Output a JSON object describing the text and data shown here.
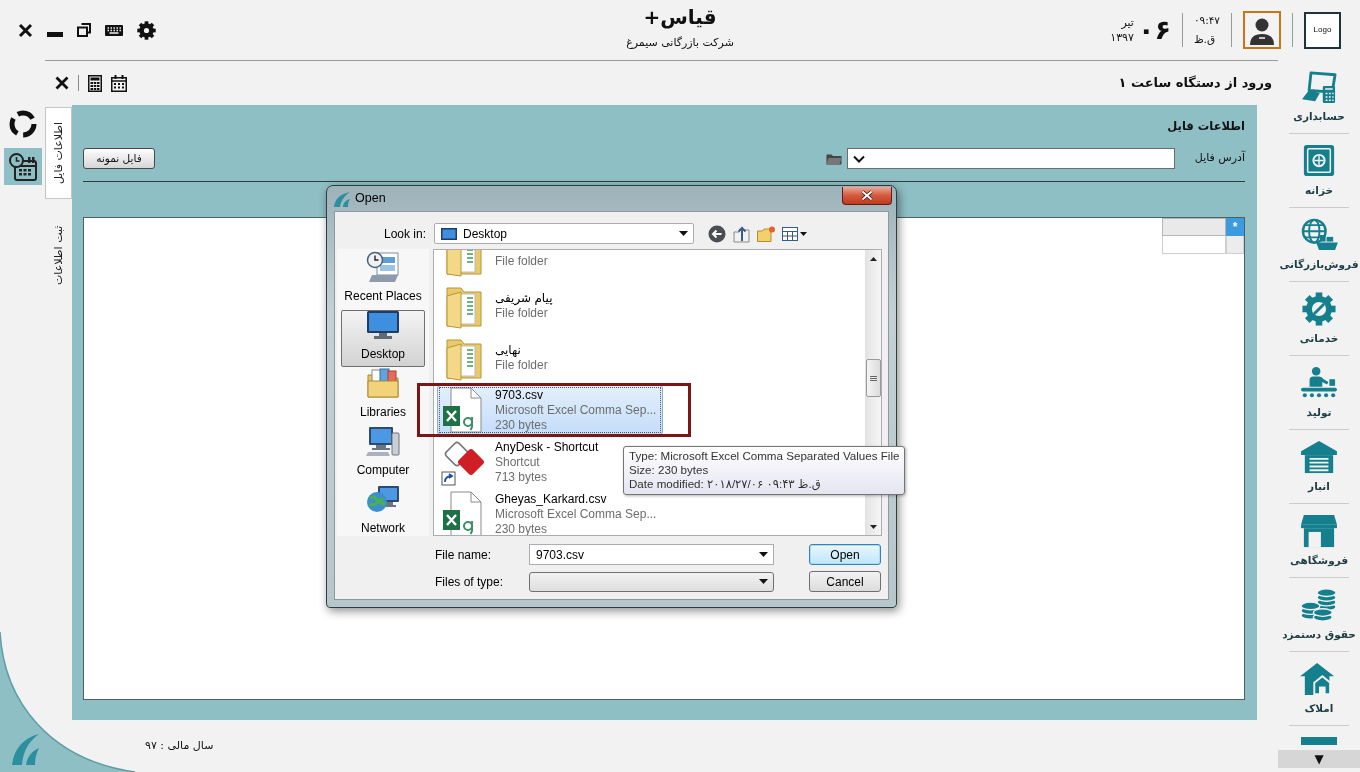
{
  "header": {
    "title": "قیاس+",
    "subtitle": "شرکت بازرگانی سیمرغ",
    "date": {
      "month": "تیر",
      "day": "۰۶",
      "year": "۱۳۹۷"
    },
    "time": {
      "clock": "۰۹:۴۷",
      "period": "ق.ظ"
    },
    "logo": "Logo"
  },
  "left_nav": [
    {
      "selected": false
    },
    {
      "selected": true
    }
  ],
  "page_title": "ورود از دستگاه ساعت ۱",
  "tabs": [
    {
      "label": "اطلاعات فایل",
      "selected": true
    },
    {
      "label": "ثبت اطلاعات",
      "selected": false
    }
  ],
  "file_panel": {
    "heading": "اطلاعات فایل",
    "path_label": "آدرس فایل",
    "sample_button": "فایل نمونه"
  },
  "grid": {
    "new_row_marker": "*"
  },
  "status_bar": {
    "fiscal_year": "سال مالی : ۹۷"
  },
  "sidebar": {
    "items": [
      {
        "label": "حسابداری"
      },
      {
        "label": "خزانه"
      },
      {
        "label": "فروش‌بازرگانی"
      },
      {
        "label": "خدماتی"
      },
      {
        "label": "تولید"
      },
      {
        "label": "انبار"
      },
      {
        "label": "فروشگاهی"
      },
      {
        "label": "حقوق دستمزد"
      },
      {
        "label": "املاک"
      }
    ],
    "scroll_down": "▼"
  },
  "dialog": {
    "title": "Open",
    "look_in_label": "Look in:",
    "look_in_value": "Desktop",
    "places": [
      {
        "label": "Recent Places",
        "selected": false
      },
      {
        "label": "Desktop",
        "selected": true
      },
      {
        "label": "Libraries",
        "selected": false
      },
      {
        "label": "Computer",
        "selected": false
      },
      {
        "label": "Network",
        "selected": false
      }
    ],
    "files": [
      {
        "kind": "folder",
        "type": "File folder",
        "selected": false,
        "highlighted": false
      },
      {
        "kind": "folder",
        "name": "پیام شریفی",
        "type": "File folder",
        "selected": false,
        "highlighted": false
      },
      {
        "kind": "folder",
        "name": "نهایی",
        "type": "File folder",
        "selected": false,
        "highlighted": false
      },
      {
        "kind": "csv",
        "name": "9703.csv",
        "type": "Microsoft Excel Comma Sep...",
        "size": "230 bytes",
        "selected": true,
        "highlighted": true
      },
      {
        "kind": "shortcut",
        "name": "AnyDesk - Shortcut",
        "type": "Shortcut",
        "size": "713 bytes",
        "selected": false,
        "highlighted": false
      },
      {
        "kind": "csv",
        "name": "Gheyas_Karkard.csv",
        "type": "Microsoft Excel Comma Sep...",
        "size": "230 bytes",
        "selected": false,
        "highlighted": false
      }
    ],
    "tooltip": [
      "Type: Microsoft Excel Comma Separated Values File",
      "Size: 230 bytes",
      "Date modified: ۲۰۱۸/۲۷/۰۶ ق.ظ ۰۹:۴۳"
    ],
    "file_name_label": "File name:",
    "file_name_value": "9703.csv",
    "file_type_label": "Files of type:",
    "buttons": [
      {
        "label": "Open",
        "default": true
      },
      {
        "label": "Cancel",
        "default": false
      }
    ]
  }
}
